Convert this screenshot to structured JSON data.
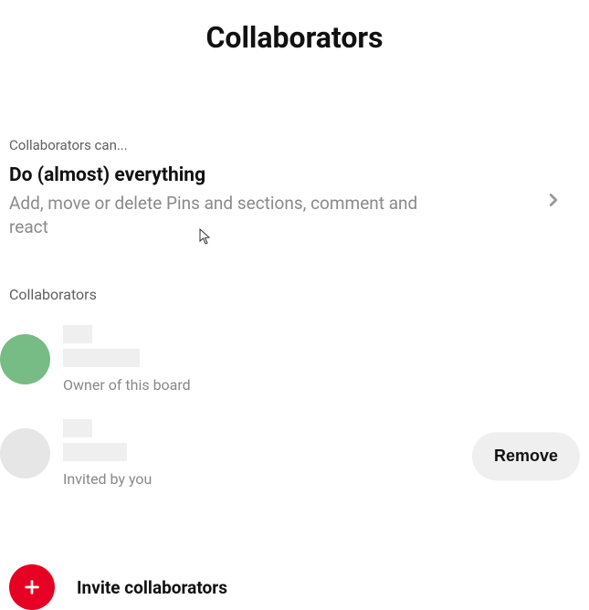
{
  "header": {
    "title": "Collaborators"
  },
  "permissions": {
    "section_label": "Collaborators can...",
    "option_title": "Do (almost) everything",
    "option_subtitle": "Add, move or delete Pins and sections, comment and react"
  },
  "collaborators": {
    "section_label": "Collaborators",
    "items": [
      {
        "role": "Owner of this board",
        "avatar_tone": "green"
      },
      {
        "role": "Invited by you",
        "avatar_tone": "gray"
      }
    ]
  },
  "actions": {
    "remove_label": "Remove",
    "invite_label": "Invite collaborators"
  }
}
